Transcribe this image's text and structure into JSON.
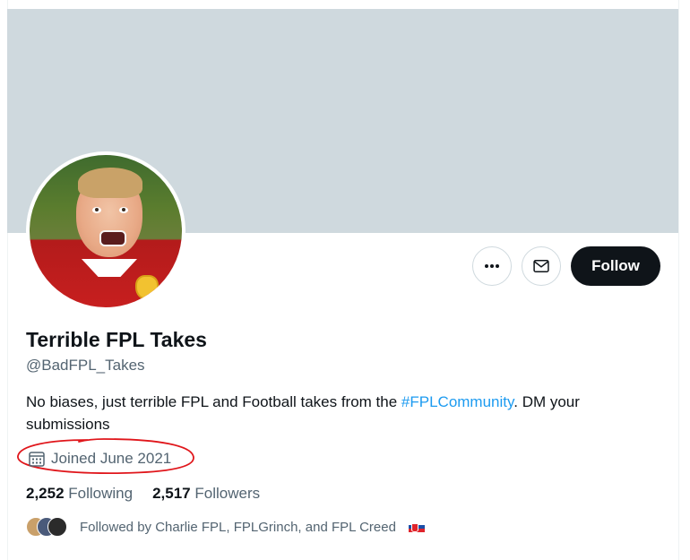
{
  "profile": {
    "display_name": "Terrible FPL Takes",
    "handle": "@BadFPL_Takes",
    "bio_prefix": "No biases, just terrible FPL and Football takes from the ",
    "bio_hashtag": "#FPLCommunity",
    "bio_suffix": ". DM your submissions",
    "joined": "Joined June 2021"
  },
  "actions": {
    "more_label": "•••",
    "follow_label": "Follow"
  },
  "stats": {
    "following_count": "2,252",
    "following_label": "Following",
    "followers_count": "2,517",
    "followers_label": "Followers"
  },
  "followed_by": {
    "text": "Followed by Charlie FPL, FPLGrinch, and FPL Creed"
  },
  "icons": {
    "more": "more-horizontal-icon",
    "mail": "mail-icon",
    "calendar": "calendar-icon",
    "flag": "slovakia-flag-icon"
  },
  "colors": {
    "banner": "#cfd9de",
    "accent": "#1d9bf0",
    "follow_button": "#0f1419",
    "secondary_text": "#536471",
    "annotation": "#e0161b"
  }
}
